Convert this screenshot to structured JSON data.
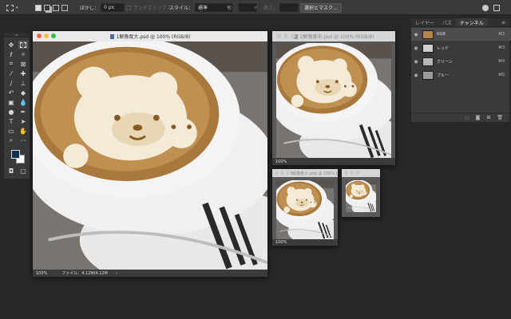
{
  "options_bar": {
    "feather_label": "ぼかし：",
    "feather_value": "0 px",
    "antialias_label": "アンチエイリアス",
    "style_label": "スタイル：",
    "style_value": "標準",
    "width_label": "幅：",
    "height_label": "高さ：",
    "select_mask_button": "選択とマスク..."
  },
  "documents": [
    {
      "title": "1解像度大.psd @ 100% (RGB/8)",
      "zoom": "100%",
      "file_info": "ファイル：4.12M/4.12M",
      "active": true
    },
    {
      "title": "2解像度中.psd @ 100% (RGB/8)",
      "zoom": "100%",
      "active": false
    },
    {
      "title": "3解像度小.psd @ 100% (RGB/8)",
      "zoom": "100%",
      "active": false
    },
    {
      "title": "",
      "active": false
    }
  ],
  "panel": {
    "tabs": [
      "レイヤー",
      "パス",
      "チャンネル"
    ],
    "active_tab": "チャンネル",
    "channels": [
      {
        "name": "RGB",
        "shortcut": "⌘2"
      },
      {
        "name": "レッド",
        "shortcut": "⌘3"
      },
      {
        "name": "グリーン",
        "shortcut": "⌘4"
      },
      {
        "name": "ブルー",
        "shortcut": "⌘5"
      }
    ]
  },
  "colors": {
    "foreground": "#14304e",
    "background": "#ffffff",
    "foam": "#f3ead8",
    "coffee": "#b2864a"
  },
  "icons": [
    "marquee-icon",
    "move-icon",
    "lasso-icon",
    "magic-wand-icon",
    "crop-icon",
    "eyedropper-icon",
    "heal-icon",
    "brush-icon",
    "stamp-icon",
    "history-brush-icon",
    "eraser-icon",
    "gradient-icon",
    "blur-icon",
    "dodge-icon",
    "pen-icon",
    "type-icon",
    "path-select-icon",
    "shape-icon",
    "hand-icon",
    "zoom-icon",
    "more-icon"
  ]
}
